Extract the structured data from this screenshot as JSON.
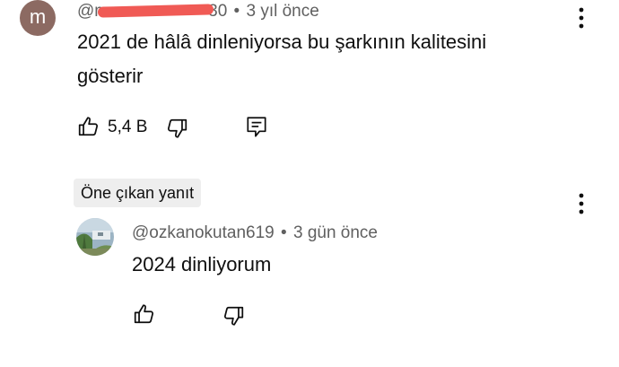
{
  "comment": {
    "avatar_letter": "m",
    "author_visible": "@m",
    "author_tail": "30",
    "separator": "•",
    "time": "3 yıl önce",
    "text_line1": "2021 de hâlâ dinleniyorsa bu şarkının kalitesini",
    "text_line2": "gösterir",
    "like_count": "5,4 B"
  },
  "reply_section": {
    "badge": "Öne çıkan yanıt"
  },
  "reply": {
    "author": "@ozkanokutan619",
    "separator": "•",
    "time": "3 gün önce",
    "text": "2024 dinliyorum"
  },
  "icons": {
    "like": "thumb-up-icon",
    "dislike": "thumb-down-icon",
    "reply": "comment-reply-icon",
    "more": "more-vertical-icon"
  },
  "colors": {
    "avatar_bg": "#8c6a62",
    "redaction": "#f05a55",
    "meta_text": "#606060"
  }
}
